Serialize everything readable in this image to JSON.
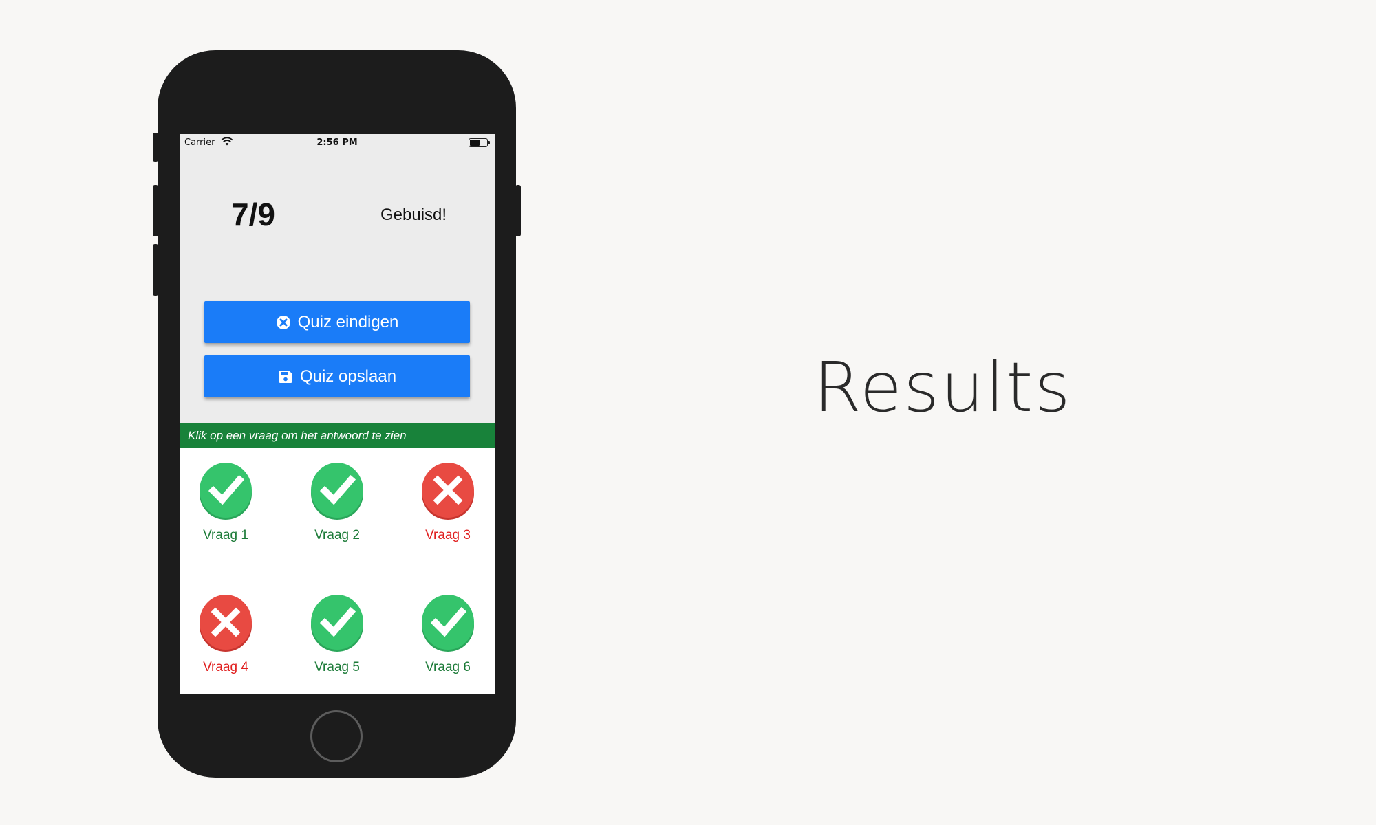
{
  "page": {
    "title": "Results"
  },
  "statusbar": {
    "carrier": "Carrier",
    "time": "2:56 PM",
    "battery_level": 0.6
  },
  "result": {
    "score": "7/9",
    "verdict": "Gebuisd!"
  },
  "buttons": {
    "end_quiz": {
      "label": "Quiz eindigen",
      "icon": "close-circle-icon"
    },
    "save_quiz": {
      "label": "Quiz opslaan",
      "icon": "floppy-disk-icon"
    }
  },
  "hint": "Klik op een vraag om het antwoord te zien",
  "colors": {
    "correct": "#35c46c",
    "wrong": "#e84a42",
    "primary": "#1a7cf8",
    "hint_bar": "#18823a"
  },
  "questions": [
    {
      "label": "Vraag 1",
      "status": "correct"
    },
    {
      "label": "Vraag 2",
      "status": "correct"
    },
    {
      "label": "Vraag 3",
      "status": "wrong"
    },
    {
      "label": "Vraag 4",
      "status": "wrong"
    },
    {
      "label": "Vraag 5",
      "status": "correct"
    },
    {
      "label": "Vraag 6",
      "status": "correct"
    }
  ]
}
